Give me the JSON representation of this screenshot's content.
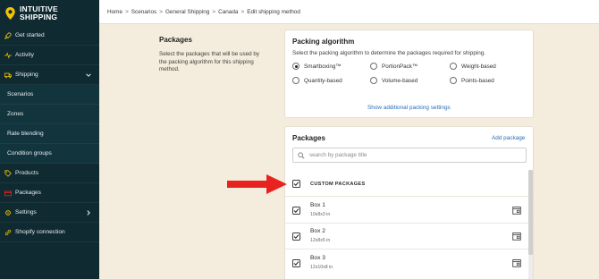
{
  "brand": {
    "line1": "INTUITIVE",
    "line2": "SHIPPING"
  },
  "sidebar": {
    "items": [
      {
        "label": "Get started",
        "icon": "rocket-icon"
      },
      {
        "label": "Activity",
        "icon": "activity-icon"
      },
      {
        "label": "Shipping",
        "icon": "truck-icon"
      },
      {
        "label": "Scenarios"
      },
      {
        "label": "Zones"
      },
      {
        "label": "Rate blending"
      },
      {
        "label": "Condition groups"
      },
      {
        "label": "Products",
        "icon": "tag-icon"
      },
      {
        "label": "Packages",
        "icon": "package-icon"
      },
      {
        "label": "Settings",
        "icon": "gear-icon"
      },
      {
        "label": "Shopify connection",
        "icon": "link-icon"
      }
    ]
  },
  "breadcrumb": [
    "Home",
    "Scenarios",
    "General Shipping",
    "Canada",
    "Edit shipping method"
  ],
  "packages_section": {
    "title": "Packages",
    "description": "Select the packages that will be used by the packing algorithm for this shipping method."
  },
  "packing_algorithm": {
    "title": "Packing algorithm",
    "subtitle": "Select the packing algorithm to determine the packages required for shipping.",
    "options": [
      "Smartboxing™",
      "PortionPack™",
      "Weight-based",
      "Quantity-based",
      "Volume-based",
      "Points-based"
    ],
    "selected": "Smartboxing™",
    "settings_link": "Show additional packing settings"
  },
  "packages_card": {
    "title": "Packages",
    "add_link": "Add package",
    "search_placeholder": "search by package title",
    "group_label": "CUSTOM PACKAGES",
    "items": [
      {
        "name": "Box 1",
        "dims": "10x8x3 in"
      },
      {
        "name": "Box 2",
        "dims": "12x8x5 in"
      },
      {
        "name": "Box 3",
        "dims": "12x10x8 in"
      }
    ]
  },
  "colors": {
    "sidebar_bg": "#0f2a31",
    "page_bg": "#f4ecdc",
    "link": "#2a6db6",
    "arrow": "#e8231f",
    "brand_pin": "#f2c300"
  }
}
